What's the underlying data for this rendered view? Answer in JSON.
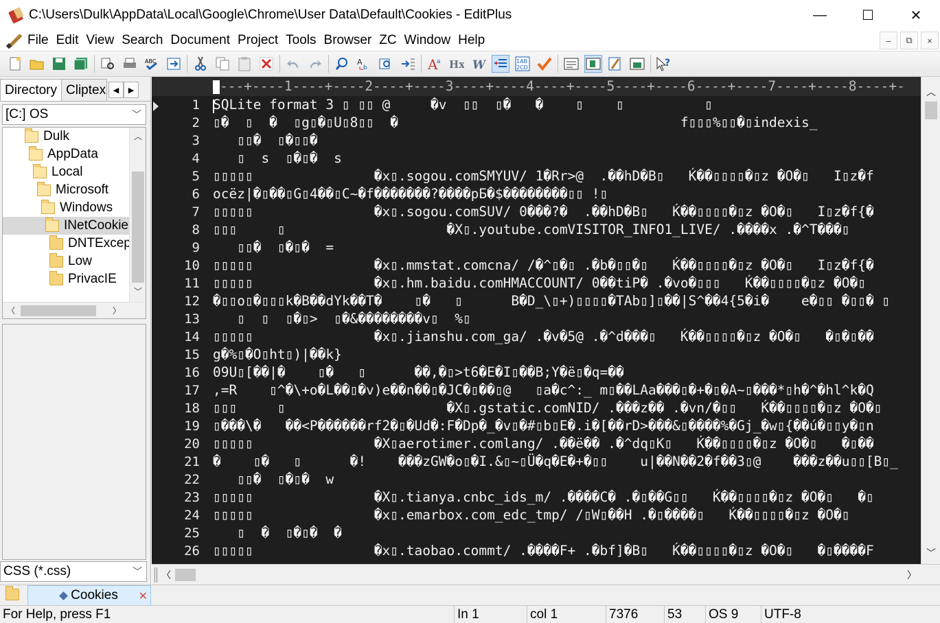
{
  "window": {
    "title": "C:\\Users\\Dulk\\AppData\\Local\\Google\\Chrome\\User Data\\Default\\Cookies - EditPlus",
    "minimize": "—",
    "maximize": "☐",
    "close": "✕"
  },
  "menu": [
    "File",
    "Edit",
    "View",
    "Search",
    "Document",
    "Project",
    "Tools",
    "Browser",
    "ZC",
    "Window",
    "Help"
  ],
  "mdi_buttons": [
    "–",
    "⧉",
    "×"
  ],
  "toolbar_icons": [
    "new-file-icon",
    "open-folder-icon",
    "save-icon",
    "save-all-icon",
    "print-preview-icon",
    "print-icon",
    "spell-check-icon",
    "refresh-icon",
    "cut-icon",
    "copy-icon",
    "paste-icon",
    "delete-icon",
    "undo-icon",
    "redo-icon",
    "find-icon",
    "replace-icon",
    "find-in-files-icon",
    "goto-line-icon",
    "font-icon",
    "heading-icon",
    "italic-icon",
    "indent-icon",
    "line-number-icon",
    "check-icon",
    "word-wrap-icon",
    "column-select-icon",
    "preview-icon",
    "output-icon",
    "help-icon"
  ],
  "sidebar": {
    "tab_directory": "Directory",
    "tab_cliptext": "Cliptex",
    "drive": "[C:] OS",
    "tree": [
      {
        "label": "Dulk",
        "indent": 0
      },
      {
        "label": "AppData",
        "indent": 1
      },
      {
        "label": "Local",
        "indent": 2
      },
      {
        "label": "Microsoft",
        "indent": 3
      },
      {
        "label": "Windows",
        "indent": 4
      },
      {
        "label": "INetCookie",
        "indent": 5,
        "selected": true
      },
      {
        "label": "DNTExcep",
        "indent": 6
      },
      {
        "label": "Low",
        "indent": 6
      },
      {
        "label": "PrivacIE",
        "indent": 6
      }
    ],
    "filter": "CSS (*.css)"
  },
  "editor": {
    "ruler": "---+----1----+----2----+----3----+----4----+----5----+----6----+----7----+----8----+-",
    "lines": [
      {
        "n": "1",
        "text": "SQLite format 3 ▯ ▯▯ @     �v  ▯▯  ▯�   �    ▯    ▯          ▯"
      },
      {
        "n": "2",
        "text": "▯�  ▯  �  ▯g▯�▯U▯8▯▯  �                                   f▯▯▯%▯▯�▯indexis_"
      },
      {
        "n": "3",
        "text": "   ▯▯�  ▯�▯▯�"
      },
      {
        "n": "4",
        "text": "   ▯  s  ▯�▯�  s"
      },
      {
        "n": "5",
        "text": "▯▯▯▯▯               �x▯.sogou.comSMYUV/ 1�Rr>@  .��hD�B▯   Ḱ��▯▯▯▯�▯z �O�▯   I▯z�f"
      },
      {
        "n": "6",
        "text": "ocëz|�▯��▯G▯4��▯C~�f�������?����pБ�$��������▯▯ !▯"
      },
      {
        "n": "7",
        "text": "▯▯▯▯▯               �x▯.sogou.comSUV/ 0���?�  .��hD�B▯   Ḱ��▯▯▯▯�▯z �O�▯   I▯z�f{�"
      },
      {
        "n": "8",
        "text": "▯▯▯     ▯                    �X▯.youtube.comVISITOR_INFO1_LIVE/ .����x .�^T���▯"
      },
      {
        "n": "9",
        "text": "   ▯▯�  ▯�▯�  ="
      },
      {
        "n": "10",
        "text": "▯▯▯▯▯               �x▯.mmstat.comcna/ /�^▯�▯ .�b�▯▯�▯   Ḱ��▯▯▯▯�▯z �O�▯   I▯z�f{�"
      },
      {
        "n": "11",
        "text": "▯▯▯▯▯               �x▯.hm.baidu.comHMACCOUNT/ 0��tiP� .�vo�▯▯▯   Ḱ��▯▯▯▯�▯z �O�▯"
      },
      {
        "n": "12",
        "text": "�▯▯o▯�▯▯▯k�B��dYk��T�    ▯�   ▯      B�D_\\▯+)▯▯▯▯�TAb▯]▯��|S^��4{5�i�    e�▯▯ �▯▯� ▯"
      },
      {
        "n": "13",
        "text": "   ▯  ▯  ▯�▯>  ▯�&��������v▯  %▯"
      },
      {
        "n": "14",
        "text": "▯▯▯▯▯               �x▯.jianshu.com_ga/ .�v�5@ .�^d���▯   Ḱ��▯▯▯▯�▯z �O�▯   �▯�▯��"
      },
      {
        "n": "15",
        "text": "g�%▯�O▯ht▯)|��k}"
      },
      {
        "n": "16",
        "text": "09U▯[��|�    ▯�   ▯      ��,�▯>t6�E�I▯��B;Y�ë▯�q=��"
      },
      {
        "n": "17",
        "text": ",=R    ▯^�\\+o�L��▯�v)e��n��▯�JC�▯��▯@   ▯a�c^:_ m▯��LAa���▯�+�▯�A~▯���*▯h�^�hl^k�Q"
      },
      {
        "n": "18",
        "text": "▯▯▯     ▯                    �X▯.gstatic.comNID/ .���z�� .�vn/�▯▯   Ḱ��▯▯▯▯�▯z �O�▯"
      },
      {
        "n": "19",
        "text": "▯���\\�   ��<P������rf2�▯�Ud�:F�Dp�_�v▯�#▯b▯E�.i�[��rD>���&▯����%�Gj_�w▯{��ú�▯▯y�▯n"
      },
      {
        "n": "20",
        "text": "▯▯▯▯▯               �X▯aerotimer.comlang/ .��ë�� .�^dq▯K▯   Ḱ��▯▯▯▯�▯z �O�▯   �▯��"
      },
      {
        "n": "21",
        "text": "�    ▯�   ▯      �!    ���zGW�o▯�I.&▯~▯Ü�q�E�+�▯▯    u|��N��2�f��3▯@    ���z��u▯▯[B▯_"
      },
      {
        "n": "22",
        "text": "   ▯▯�  ▯�▯�  w"
      },
      {
        "n": "23",
        "text": "▯▯▯▯▯               �X▯.tianya.cnbc_ids_m/ .����C� .�▯��G▯▯   Ḱ��▯▯▯▯�▯z �O�▯   �▯"
      },
      {
        "n": "24",
        "text": "▯▯▯▯▯               �x▯.emarbox.com_edc_tmp/ /▯W▯��H .�▯����▯   Ḱ��▯▯▯▯�▯z �O�▯"
      },
      {
        "n": "25",
        "text": "   ▯  �  ▯�▯�  �"
      },
      {
        "n": "26",
        "text": "▯▯▯▯▯               �x▯.taobao.commt/ .����F+ .�bf]�B▯   Ḱ��▯▯▯▯�▯z �O�▯   �▯����F"
      }
    ]
  },
  "document_tab": {
    "label": "Cookies"
  },
  "status": {
    "help": "For Help, press F1",
    "ln": "In 1",
    "col": "col 1",
    "size": "7376",
    "num": "53",
    "os": "OS 9",
    "encoding": "UTF-8"
  }
}
